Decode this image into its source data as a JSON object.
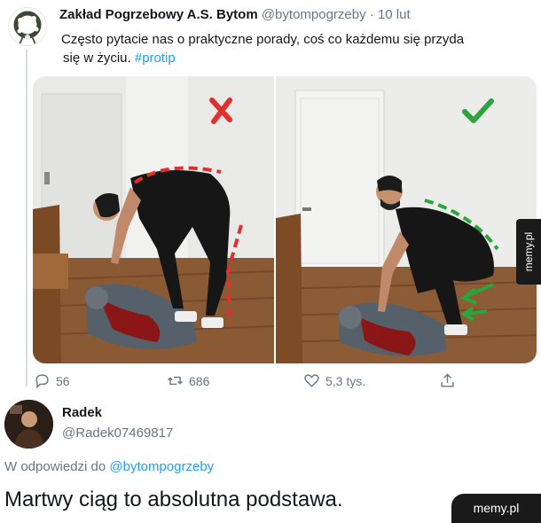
{
  "tweet": {
    "display_name": "Zakład Pogrzebowy A.S. Bytom",
    "handle": "@bytompogrzeby",
    "separator": "·",
    "date": "10 lut",
    "text_line1": "Często pytacie nas o praktyczne porady, coś co każdemu się przyda",
    "text_line2": "się w życiu.",
    "hashtag": "#protip"
  },
  "images": {
    "left_mark": "x-mark-icon",
    "right_mark": "check-mark-icon",
    "colors": {
      "wrong": "#e0302d",
      "right": "#2aa43b"
    }
  },
  "actions": {
    "reply_count": "56",
    "retweet_count": "686",
    "like_count": "5,3 tys."
  },
  "watermark": {
    "side_label": "memy.pl",
    "corner_label": "memy.pl"
  },
  "reply": {
    "display_name": "Radek",
    "handle": "@Radek07469817",
    "reply_prefix": "W odpowiedzi do",
    "reply_to_handle": "@bytompogrzeby",
    "text": "Martwy ciąg to absolutna podstawa."
  },
  "colors": {
    "link": "#1da1f2",
    "muted": "#657786"
  }
}
